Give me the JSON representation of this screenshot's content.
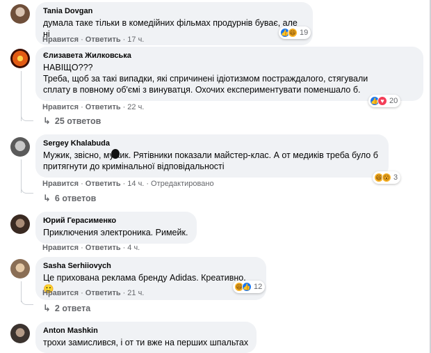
{
  "comments": [
    {
      "author": "Tania Dovgan",
      "text": "думала таке тільки в комедійних фільмах продурнів буває, але ні",
      "like": "Нравится",
      "reply": "Ответить",
      "time": "17 ч.",
      "reactions": "19"
    },
    {
      "author": "Єлизавета Жилковська",
      "text": "НАВІЩО???\nТреба, щоб за такі випадки, які спричинені ідіотизмом постраждалого, стягували\nсплату в повному об'ємі з винуватця. Охочих експериментувати поменшало б.",
      "like": "Нравится",
      "reply": "Ответить",
      "time": "22 ч.",
      "reactions": "20",
      "replies": "25 ответов"
    },
    {
      "author": "Sergey Khalabuda",
      "text": "Мужик, звісно, мужик. Рятівники показали майстер-клас. А от медиків треба було б\nпритягнути до кримінальної відповідальності",
      "like": "Нравится",
      "reply": "Ответить",
      "time": "14 ч.",
      "edited": "Отредактировано",
      "reactions": "3",
      "replies": "6 ответов"
    },
    {
      "author": "Юрий Герасименко",
      "text": "Приключения электроника. Римейк.",
      "like": "Нравится",
      "reply": "Ответить",
      "time": "4 ч."
    },
    {
      "author": "Sasha Serhiiovych",
      "text": "Це прихована реклама бренду Adidas. Креативно. 🙂",
      "like": "Нравится",
      "reply": "Ответить",
      "time": "21 ч.",
      "reactions": "12",
      "replies": "2 ответа"
    },
    {
      "author": "Anton Mashkin",
      "text": "трохи замислився, і от ти вже на перших шпальтах"
    }
  ],
  "dot": "·",
  "arrow": "↳",
  "icons": {
    "like": "like-reaction-icon",
    "love": "love-reaction-icon",
    "haha": "haha-reaction-icon",
    "wow": "wow-reaction-icon"
  },
  "colors": {
    "bubble": "#f0f2f5",
    "meta": "#65676b",
    "like": "#1877f2",
    "love": "#f33e58",
    "haha": "#f7b125"
  }
}
